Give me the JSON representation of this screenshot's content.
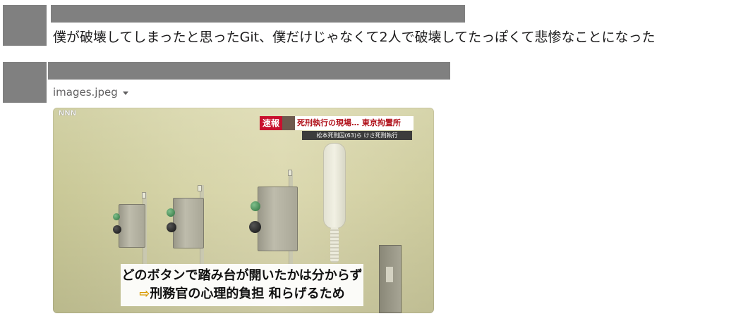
{
  "messages": [
    {
      "text": "僕が破壊してしまったと思ったGit、僕だけじゃなくて2人で破壊してたっぽくて悲惨なことになった"
    },
    {
      "attachment": {
        "file_name": "images.jpeg",
        "image": {
          "logo_text": "NNN",
          "ticker": {
            "badge": "速報",
            "headline": "死刑執行の現場… 東京拘置所",
            "subline": "松本死刑囚(63)ら けさ死刑執行"
          },
          "caption": {
            "line1": "どのボタンで踏み台が開いたかは分からず",
            "arrow": "⇨",
            "line2": "刑務官の心理的負担 和らげるため"
          }
        }
      }
    }
  ],
  "colors": {
    "redaction": "#808080",
    "text": "#1d1c1d",
    "muted": "#616061",
    "ticker_red": "#c8102e"
  }
}
